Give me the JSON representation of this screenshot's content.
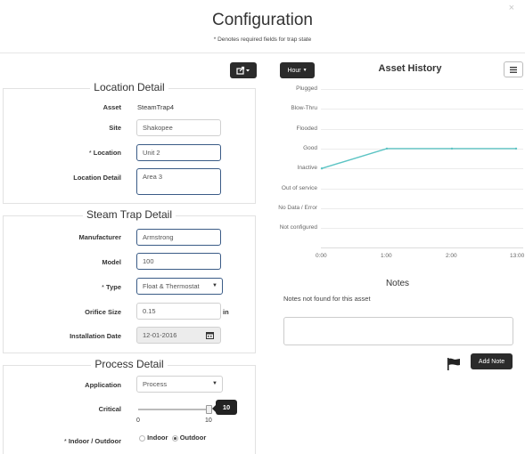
{
  "header": {
    "title": "Configuration",
    "subtitle": "* Denotes required fields for trap state",
    "close_icon": "×"
  },
  "location_detail": {
    "legend": "Location Detail",
    "asset_label": "Asset",
    "asset_value": "SteamTrap4",
    "site_label": "Site",
    "site_value": "Shakopee",
    "location_label_req": "* ",
    "location_label": "Location",
    "location_value": "Unit 2",
    "location_detail_label": "Location Detail",
    "location_detail_value": "Area 3"
  },
  "steam_trap_detail": {
    "legend": "Steam Trap Detail",
    "manufacturer_label": "Manufacturer",
    "manufacturer_value": "Armstrong",
    "model_label": "Model",
    "model_value": "100",
    "type_label_req": "* ",
    "type_label": "Type",
    "type_value": "Float & Thermostat",
    "orifice_label": "Orifice Size",
    "orifice_value": "0.15",
    "orifice_unit": "in",
    "install_label": "Installation Date",
    "install_value": "12-01-2016"
  },
  "process_detail": {
    "legend": "Process Detail",
    "application_label": "Application",
    "application_value": "Process",
    "critical_label": "Critical",
    "critical_value": "10",
    "critical_min": "0",
    "critical_max": "10",
    "critical_level": 1.0,
    "indoor_label_req": "* ",
    "indoor_label": "Indoor / Outdoor",
    "indoor_option": "Indoor",
    "outdoor_option": "Outdoor",
    "selected": "Outdoor"
  },
  "asset_history": {
    "period_button": "Hour",
    "title": "Asset History",
    "menu_icon": "hamburger-icon",
    "share_icon": "share-icon"
  },
  "chart_data": {
    "type": "line",
    "title": "Asset History",
    "categories_y": [
      "Plugged",
      "Blow-Thru",
      "Flooded",
      "Good",
      "Inactive",
      "Out of service",
      "No Data / Error",
      "Not configured"
    ],
    "x_ticks": [
      "0:00",
      "1:00",
      "2:00",
      "13:00"
    ],
    "series": [
      {
        "x": [
          "0:00",
          "1:00",
          "2:00",
          "13:00"
        ],
        "values": [
          "Inactive",
          "Good",
          "Good",
          "Good"
        ]
      }
    ],
    "grid": true,
    "line_color": "#5cc4c4"
  },
  "notes": {
    "title": "Notes",
    "empty_text": "Notes not found for this asset",
    "textarea_value": "",
    "add_button": "Add Note",
    "flag_icon": "flag-icon"
  }
}
